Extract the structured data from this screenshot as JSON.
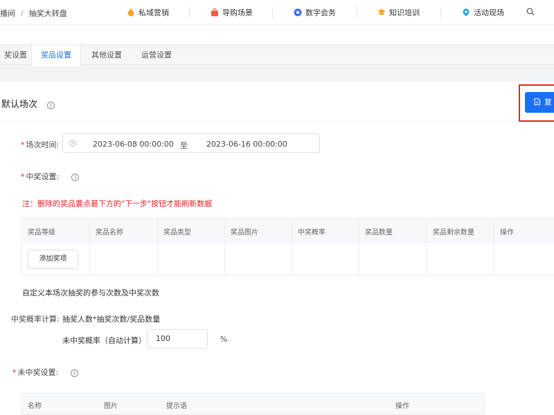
{
  "header": {
    "breadcrumb": [
      "播间",
      "抽奖大转盘"
    ],
    "breadcrumb_sep": "/",
    "nav": [
      {
        "label": "私域营销",
        "icon": "private-domain-icon",
        "color": "#f5a623"
      },
      {
        "label": "导购场景",
        "icon": "shopping-bag-icon",
        "color": "#f05a3c"
      },
      {
        "label": "数字会务",
        "icon": "conference-icon",
        "color": "#3b6ff2"
      },
      {
        "label": "知识培训",
        "icon": "graduation-cap-icon",
        "color": "#f5a623"
      },
      {
        "label": "活动现场",
        "icon": "location-pin-icon",
        "color": "#22a0f0"
      }
    ]
  },
  "tabs": [
    {
      "label": "奖设置"
    },
    {
      "label": "奖品设置"
    },
    {
      "label": "其他设置"
    },
    {
      "label": "运营设置"
    }
  ],
  "active_tab": 1,
  "section": {
    "title": "默认场次",
    "copy_button": "复"
  },
  "form": {
    "time_label": "场次时间:",
    "start": "2023-06-08 00:00:00",
    "to": "至",
    "end": "2023-06-16 00:00:00",
    "win_label": "中奖设置:",
    "warning": "注：删除的奖品要点最下方的\"下一步\"按钮才能刷新数据",
    "prize_columns": [
      "奖品等级",
      "奖品名称",
      "奖品类型",
      "奖品图片",
      "中奖概率",
      "奖品数量",
      "奖品剩余数量",
      "操作"
    ],
    "add_prize": "添加奖项",
    "custom_text": "自定义本场次抽奖的参与次数及中奖次数",
    "calc_label": "中奖概率计算:",
    "calc_formula": "抽奖人数*抽奖次数/奖品数量",
    "no_win_rate_label": "未中奖概率（自动计算）",
    "no_win_rate_value": "100",
    "percent": "%",
    "no_win_label": "未中奖设置:",
    "no_win_columns": [
      "名称",
      "图片",
      "提示语",
      "操作"
    ]
  },
  "colors": {
    "accent": "#1a6ff5",
    "danger": "#e02424"
  }
}
